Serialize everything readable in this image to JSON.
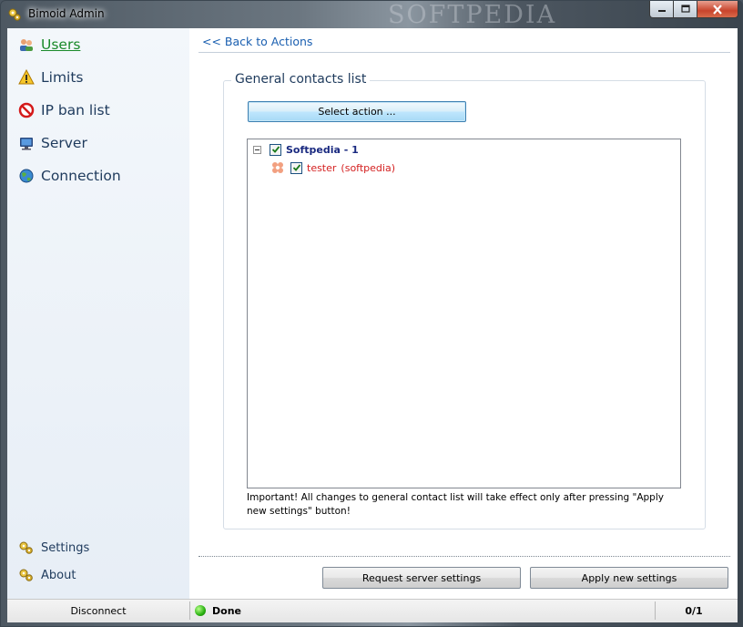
{
  "window": {
    "title": "Bimoid Admin",
    "watermark": "SOFTPEDIA"
  },
  "sidebar": {
    "items": [
      {
        "label": "Users",
        "icon": "users-icon",
        "active": true
      },
      {
        "label": "Limits",
        "icon": "warning-icon"
      },
      {
        "label": "IP ban list",
        "icon": "ban-icon"
      },
      {
        "label": "Server",
        "icon": "monitor-icon"
      },
      {
        "label": "Connection",
        "icon": "globe-icon"
      }
    ],
    "bottom_items": [
      {
        "label": "Settings",
        "icon": "gears-icon"
      },
      {
        "label": "About",
        "icon": "gears-icon"
      }
    ]
  },
  "main": {
    "back_link": "<< Back to Actions",
    "group_title": "General contacts list",
    "select_action_label": "Select action ...",
    "tree": {
      "group": {
        "name": "Softpedia - 1",
        "checked": true,
        "expanded": true
      },
      "contacts": [
        {
          "name": "tester",
          "note": "(softpedia)",
          "checked": true,
          "icon": "contact-offline-icon"
        }
      ]
    },
    "note": "Important! All changes to general contact list will take effect only after pressing \"Apply new settings\" button!",
    "request_button": "Request server settings",
    "apply_button": "Apply new settings"
  },
  "statusbar": {
    "disconnect_label": "Disconnect",
    "status_text": "Done",
    "counter": "0/1"
  },
  "colors": {
    "link_blue": "#1a5fb0",
    "active_green": "#1a8a2a",
    "group_navy": "#1a2a80",
    "contact_red": "#d42020"
  }
}
